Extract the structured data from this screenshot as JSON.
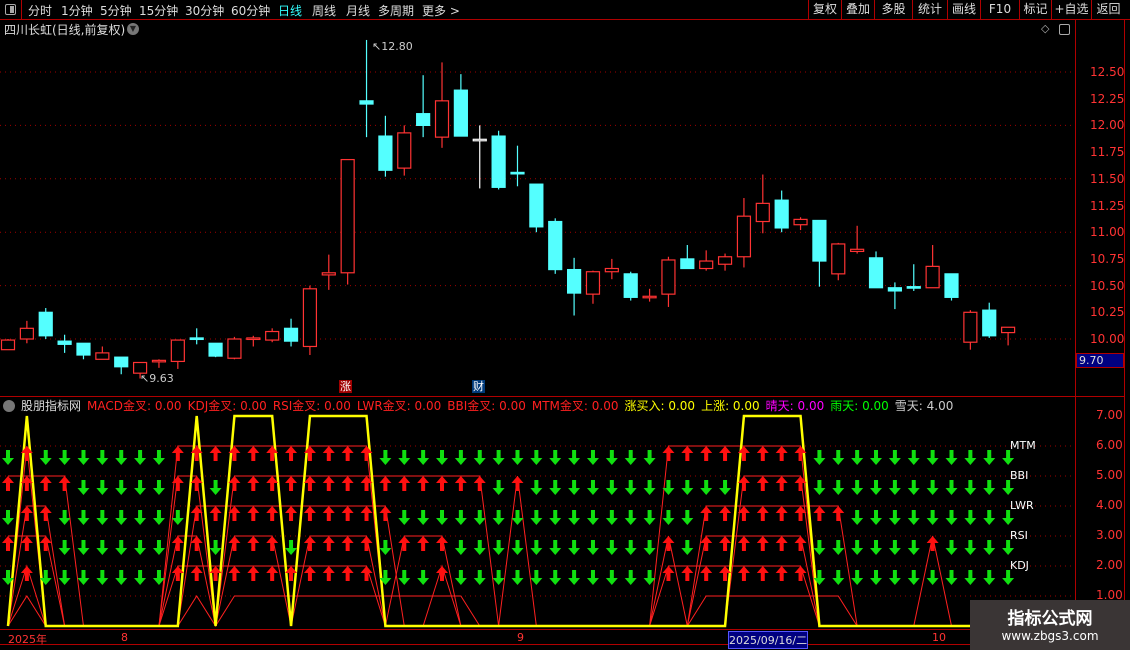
{
  "toolbar": {
    "periods": [
      "分时",
      "1分钟",
      "5分钟",
      "15分钟",
      "30分钟",
      "60分钟",
      "日线",
      "周线",
      "月线",
      "多周期",
      "更多 >"
    ],
    "active": "日线",
    "buttons": [
      "复权",
      "叠加",
      "多股",
      "统计",
      "画线",
      "F10",
      "标记",
      "+自选",
      "返回"
    ]
  },
  "chart": {
    "title": "四川长虹(日线,前复权)",
    "high_label": "12.80",
    "low_label": "9.63",
    "current_price": "9.70",
    "price_ticks": [
      "12.50",
      "12.25",
      "12.00",
      "11.75",
      "11.50",
      "11.25",
      "11.00",
      "10.75",
      "10.50",
      "10.25",
      "10.00"
    ],
    "tags": [
      {
        "text": "涨",
        "color": "#a00000"
      },
      {
        "text": "财",
        "color": "#003a7a"
      }
    ]
  },
  "indicator": {
    "name": "股朋指标网",
    "values": [
      {
        "label": "MACD金叉: 0.00",
        "color": "#ff2020"
      },
      {
        "label": "KDJ金叉: 0.00",
        "color": "#ff2020"
      },
      {
        "label": "RSI金叉: 0.00",
        "color": "#ff2020"
      },
      {
        "label": "LWR金叉: 0.00",
        "color": "#ff2020"
      },
      {
        "label": "BBI金叉: 0.00",
        "color": "#ff2020"
      },
      {
        "label": "MTM金叉: 0.00",
        "color": "#ff2020"
      },
      {
        "label": "涨买入: 0.00",
        "color": "#ffff00"
      },
      {
        "label": "上涨: 0.00",
        "color": "#ffff00"
      },
      {
        "label": "晴天: 0.00",
        "color": "#ff00ff"
      },
      {
        "label": "雨天: 0.00",
        "color": "#00ff00"
      },
      {
        "label": "雪天: 4.00",
        "color": "#cccccc"
      }
    ],
    "ticks": [
      "7.00",
      "6.00",
      "5.00",
      "4.00",
      "3.00",
      "2.00",
      "1.00"
    ],
    "row_labels": [
      "MTM",
      "BBI",
      "LWR",
      "RSI",
      "KDJ"
    ]
  },
  "dates": {
    "year": "2025年",
    "m8": "8",
    "m9": "9",
    "selected": "2025/09/16/二",
    "m10": "10"
  },
  "watermark": {
    "title": "指标公式网",
    "url": "www.zbgs3.com"
  },
  "chart_data": {
    "type": "candlestick",
    "ohlc": [
      [
        9.9,
        10.0,
        9.9,
        9.99
      ],
      [
        10.0,
        10.17,
        9.96,
        10.1
      ],
      [
        10.25,
        10.29,
        10.0,
        10.03
      ],
      [
        9.98,
        10.04,
        9.87,
        9.95
      ],
      [
        9.96,
        9.96,
        9.81,
        9.85
      ],
      [
        9.81,
        9.93,
        9.81,
        9.87
      ],
      [
        9.83,
        9.83,
        9.67,
        9.74
      ],
      [
        9.68,
        9.78,
        9.63,
        9.78
      ],
      [
        9.79,
        9.81,
        9.73,
        9.8
      ],
      [
        9.79,
        9.99,
        9.72,
        9.99
      ],
      [
        10.01,
        10.1,
        9.95,
        10.0
      ],
      [
        9.96,
        9.96,
        9.83,
        9.84
      ],
      [
        9.82,
        10.02,
        9.81,
        10.0
      ],
      [
        10.01,
        10.03,
        9.93,
        10.01
      ],
      [
        9.99,
        10.1,
        9.97,
        10.07
      ],
      [
        10.1,
        10.19,
        9.93,
        9.98
      ],
      [
        9.93,
        10.5,
        9.85,
        10.47
      ],
      [
        10.6,
        10.79,
        10.46,
        10.62
      ],
      [
        10.62,
        11.68,
        10.51,
        11.68
      ],
      [
        12.23,
        12.8,
        11.89,
        12.2
      ],
      [
        11.9,
        12.09,
        11.52,
        11.58
      ],
      [
        11.6,
        12.0,
        11.53,
        11.93
      ],
      [
        12.11,
        12.47,
        11.89,
        12.0
      ],
      [
        11.89,
        12.59,
        11.79,
        12.23
      ],
      [
        12.33,
        12.48,
        11.9,
        11.9
      ],
      [
        11.87,
        12.0,
        11.41,
        11.87
      ],
      [
        11.9,
        11.95,
        11.4,
        11.42
      ],
      [
        11.56,
        11.81,
        11.43,
        11.55
      ],
      [
        11.45,
        11.45,
        11.0,
        11.05
      ],
      [
        11.1,
        11.13,
        10.61,
        10.65
      ],
      [
        10.65,
        10.76,
        10.22,
        10.43
      ],
      [
        10.42,
        10.64,
        10.33,
        10.63
      ],
      [
        10.63,
        10.75,
        10.56,
        10.66
      ],
      [
        10.61,
        10.63,
        10.36,
        10.39
      ],
      [
        10.39,
        10.47,
        10.35,
        10.4
      ],
      [
        10.42,
        10.77,
        10.3,
        10.74
      ],
      [
        10.75,
        10.88,
        10.66,
        10.66
      ],
      [
        10.66,
        10.83,
        10.64,
        10.73
      ],
      [
        10.7,
        10.8,
        10.64,
        10.77
      ],
      [
        10.77,
        11.32,
        10.67,
        11.15
      ],
      [
        11.1,
        11.54,
        10.99,
        11.27
      ],
      [
        11.3,
        11.39,
        11.0,
        11.04
      ],
      [
        11.07,
        11.14,
        11.02,
        11.12
      ],
      [
        11.11,
        11.11,
        10.49,
        10.73
      ],
      [
        10.61,
        10.9,
        10.55,
        10.89
      ],
      [
        10.82,
        11.06,
        10.8,
        10.84
      ],
      [
        10.76,
        10.82,
        10.48,
        10.48
      ],
      [
        10.48,
        10.53,
        10.28,
        10.45
      ],
      [
        10.49,
        10.7,
        10.45,
        10.48
      ],
      [
        10.48,
        10.88,
        10.48,
        10.68
      ],
      [
        10.61,
        10.61,
        10.36,
        10.39
      ],
      [
        9.97,
        10.27,
        9.9,
        10.25
      ],
      [
        10.27,
        10.34,
        10.01,
        10.03
      ],
      [
        10.06,
        10.11,
        9.94,
        10.11
      ]
    ],
    "price_range": [
      9.55,
      12.85
    ],
    "signals": {
      "MTM": [
        1,
        9,
        10,
        11,
        12,
        13,
        14,
        15,
        16,
        17,
        18,
        19,
        35,
        36,
        37,
        38,
        39,
        40,
        41,
        42
      ],
      "BBI": [
        0,
        1,
        2,
        3,
        9,
        10,
        12,
        13,
        14,
        15,
        16,
        17,
        18,
        19,
        20,
        21,
        22,
        23,
        24,
        25,
        27,
        39,
        40,
        41,
        42
      ],
      "LWR": [
        1,
        2,
        10,
        11,
        12,
        13,
        14,
        15,
        16,
        17,
        18,
        19,
        20,
        37,
        38,
        39,
        40,
        41,
        42,
        43,
        44
      ],
      "RSI": [
        0,
        1,
        2,
        9,
        10,
        12,
        13,
        14,
        16,
        17,
        18,
        19,
        21,
        22,
        23,
        35,
        37,
        38,
        39,
        40,
        41,
        42,
        49
      ],
      "KDJ": [
        1,
        9,
        10,
        11,
        12,
        13,
        14,
        15,
        16,
        17,
        18,
        19,
        23,
        35,
        36,
        37,
        38,
        39,
        40,
        41,
        42
      ],
      "L1": [
        1,
        10,
        12,
        13,
        14,
        15,
        16,
        17,
        18,
        19,
        20,
        21,
        22,
        23,
        24,
        37,
        38,
        39,
        40,
        41,
        42,
        43,
        44
      ]
    },
    "levels": {
      "MTM": 6,
      "BBI": 5,
      "LWR": 4,
      "RSI": 3,
      "KDJ": 2,
      "L1": 1
    },
    "yellow": [
      0,
      7,
      0,
      0,
      0,
      0,
      0,
      0,
      0,
      0,
      7,
      0,
      7,
      7,
      7,
      0,
      7,
      7,
      7,
      7,
      0,
      0,
      0,
      0,
      0,
      0,
      0,
      0,
      0,
      0,
      0,
      0,
      0,
      0,
      0,
      0,
      0,
      0,
      0,
      7,
      7,
      7,
      7,
      0,
      0,
      0,
      0,
      0,
      0,
      0,
      0,
      0,
      0,
      0
    ],
    "ind_range": [
      0,
      7.3
    ]
  }
}
